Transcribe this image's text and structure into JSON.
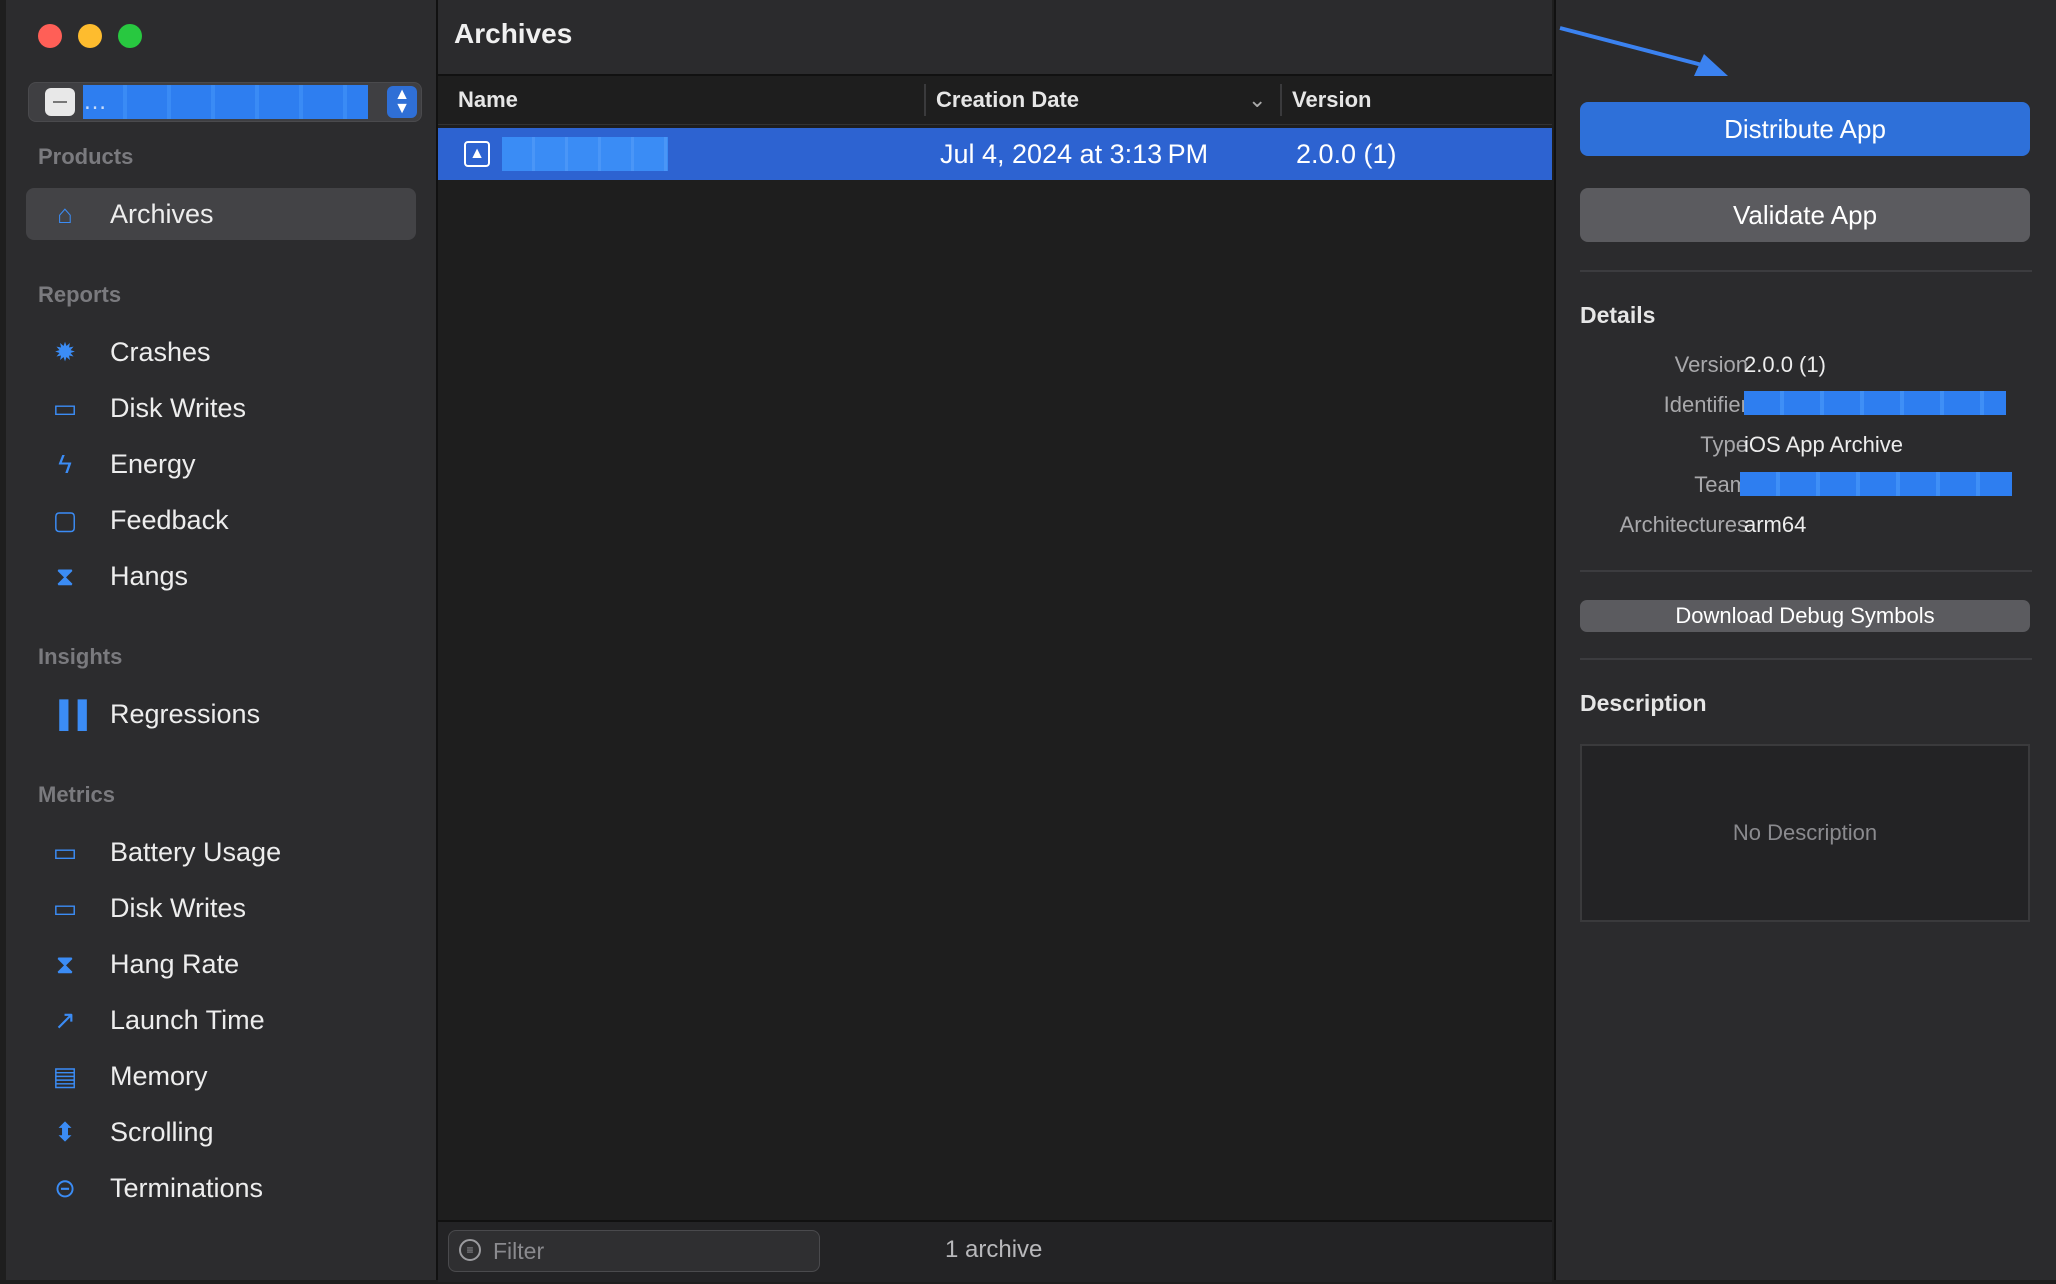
{
  "sidebar": {
    "scheme_label": "…",
    "products_title": "Products",
    "products": [
      {
        "label": "Archives",
        "icon": "archive-icon",
        "glyph": "⌂"
      }
    ],
    "reports_title": "Reports",
    "reports": [
      {
        "label": "Crashes",
        "icon": "crash-burst-icon",
        "glyph": "✹"
      },
      {
        "label": "Disk Writes",
        "icon": "disk-icon",
        "glyph": "▭"
      },
      {
        "label": "Energy",
        "icon": "lightning-icon",
        "glyph": "ϟ"
      },
      {
        "label": "Feedback",
        "icon": "speech-bubble-icon",
        "glyph": "▢"
      },
      {
        "label": "Hangs",
        "icon": "hourglass-icon",
        "glyph": "⧗"
      }
    ],
    "insights_title": "Insights",
    "insights": [
      {
        "label": "Regressions",
        "icon": "bar-chart-icon",
        "glyph": "▐▐"
      }
    ],
    "metrics_title": "Metrics",
    "metrics": [
      {
        "label": "Battery Usage",
        "icon": "battery-icon",
        "glyph": "▭"
      },
      {
        "label": "Disk Writes",
        "icon": "disk-icon",
        "glyph": "▭"
      },
      {
        "label": "Hang Rate",
        "icon": "hourglass-icon",
        "glyph": "⧗"
      },
      {
        "label": "Launch Time",
        "icon": "rocket-icon",
        "glyph": "↗"
      },
      {
        "label": "Memory",
        "icon": "memory-chip-icon",
        "glyph": "▤"
      },
      {
        "label": "Scrolling",
        "icon": "scrolling-icon",
        "glyph": "⬍"
      },
      {
        "label": "Terminations",
        "icon": "minus-circle-icon",
        "glyph": "⊝"
      }
    ]
  },
  "main": {
    "title": "Archives",
    "columns": {
      "name": "Name",
      "creation_date": "Creation Date",
      "version": "Version"
    },
    "rows": [
      {
        "name": "",
        "creation_date": "Jul 4, 2024 at 3:13 PM",
        "version": "2.0.0 (1)"
      }
    ],
    "filter_placeholder": "Filter",
    "count_label": "1 archive"
  },
  "inspector": {
    "distribute_label": "Distribute App",
    "validate_label": "Validate App",
    "details_title": "Details",
    "details": {
      "version_label": "Version",
      "version_value": "2.0.0 (1)",
      "identifier_label": "Identifier",
      "identifier_value": "",
      "type_label": "Type",
      "type_value": "iOS App Archive",
      "team_label": "Team",
      "team_value": "",
      "arch_label": "Architectures",
      "arch_value": "arm64"
    },
    "download_symbols_label": "Download Debug Symbols",
    "description_title": "Description",
    "description_empty": "No Description"
  },
  "colors": {
    "accent": "#2e70d9",
    "selection": "#2d63d1",
    "icon_blue": "#3b8cf5",
    "annotation_arrow": "#3b82f0"
  }
}
